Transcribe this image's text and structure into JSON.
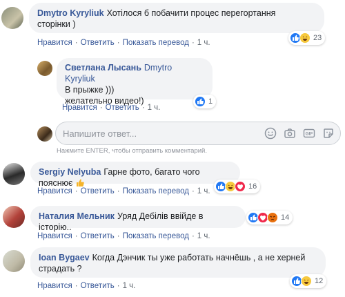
{
  "labels": {
    "like": "Нравится",
    "reply": "Ответить",
    "translate": "Показать перевод",
    "dot": "·"
  },
  "comments": [
    {
      "author": "Dmytro Kyryliuk",
      "text_line1": "Хотілося б побачити процес перегортання",
      "text_line2": "сторінки )",
      "time": "1 ч.",
      "reaction_count": "23",
      "reactions": [
        "like",
        "laugh"
      ]
    },
    {
      "author": "Светлана Лысань",
      "mention": "Dmytro Kyryliuk",
      "text_line1": "В прыжке )))",
      "text_line2": "желательно видео!)",
      "time": "1 ч.",
      "reaction_count": "1",
      "reactions": [
        "like"
      ]
    },
    {
      "author": "Sergiy Nelyuba",
      "text_line1": "Гарне фото, багато чого пояснює",
      "time": "1 ч.",
      "reaction_count": "16",
      "reactions": [
        "like",
        "laugh",
        "love"
      ]
    },
    {
      "author": "Наталия Мельник",
      "text_line1": "Уряд Дебілів ввійде в історію..",
      "time": "1 ч.",
      "reaction_count": "14",
      "reactions": [
        "like",
        "love",
        "angry"
      ]
    },
    {
      "author": "Ioan Bygaev",
      "text_line1": "Когда Дэнчик ты уже работать начнёшь , а не херней",
      "text_line2": "страдать ?",
      "time": "1 ч.",
      "reaction_count": "12",
      "reactions": [
        "like",
        "laugh"
      ]
    }
  ],
  "reply_box": {
    "placeholder": "Напишите ответ...",
    "hint": "Нажмите ENTER, чтобы отправить комментарий.",
    "icons": [
      "emoji-icon",
      "camera-icon",
      "gif-icon",
      "sticker-icon"
    ]
  },
  "colors": {
    "link": "#385898",
    "bubble": "#f2f3f5",
    "like": "#2078f4",
    "laugh": "#f7c93d",
    "love": "#f0284a",
    "angry": "#e9710f"
  }
}
